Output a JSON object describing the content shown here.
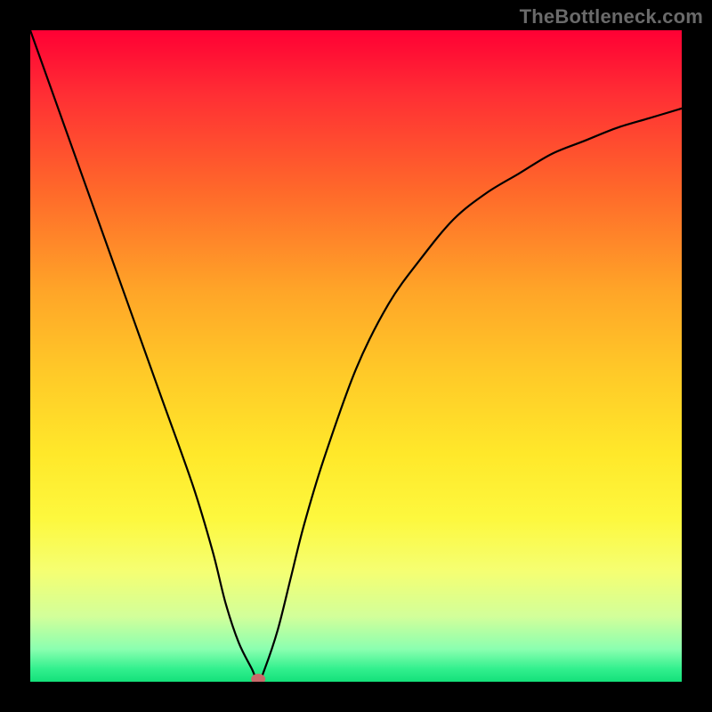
{
  "watermark": "TheBottleneck.com",
  "colors": {
    "background": "#000000",
    "gradient_top": "#ff0034",
    "gradient_mid": "#ffe82a",
    "gradient_bottom": "#14e07a",
    "curve": "#000000",
    "dot": "#c96a6a"
  },
  "chart_data": {
    "type": "line",
    "title": "",
    "xlabel": "",
    "ylabel": "",
    "xlim": [
      0,
      100
    ],
    "ylim": [
      0,
      100
    ],
    "x": [
      0,
      5,
      10,
      15,
      20,
      25,
      28,
      30,
      32,
      34,
      35,
      36,
      38,
      40,
      42,
      45,
      50,
      55,
      60,
      65,
      70,
      75,
      80,
      85,
      90,
      95,
      100
    ],
    "values": [
      100,
      86,
      72,
      58,
      44,
      30,
      20,
      12,
      6,
      2,
      0,
      2,
      8,
      16,
      24,
      34,
      48,
      58,
      65,
      71,
      75,
      78,
      81,
      83,
      85,
      86.5,
      88
    ],
    "minimum_x": 35,
    "minimum_y": 0,
    "note": "V-shaped bottleneck curve; values estimated from pixel positions on a 0–100 axis where y=0 is at the bottom (green) and y=100 is at the top (red)."
  }
}
